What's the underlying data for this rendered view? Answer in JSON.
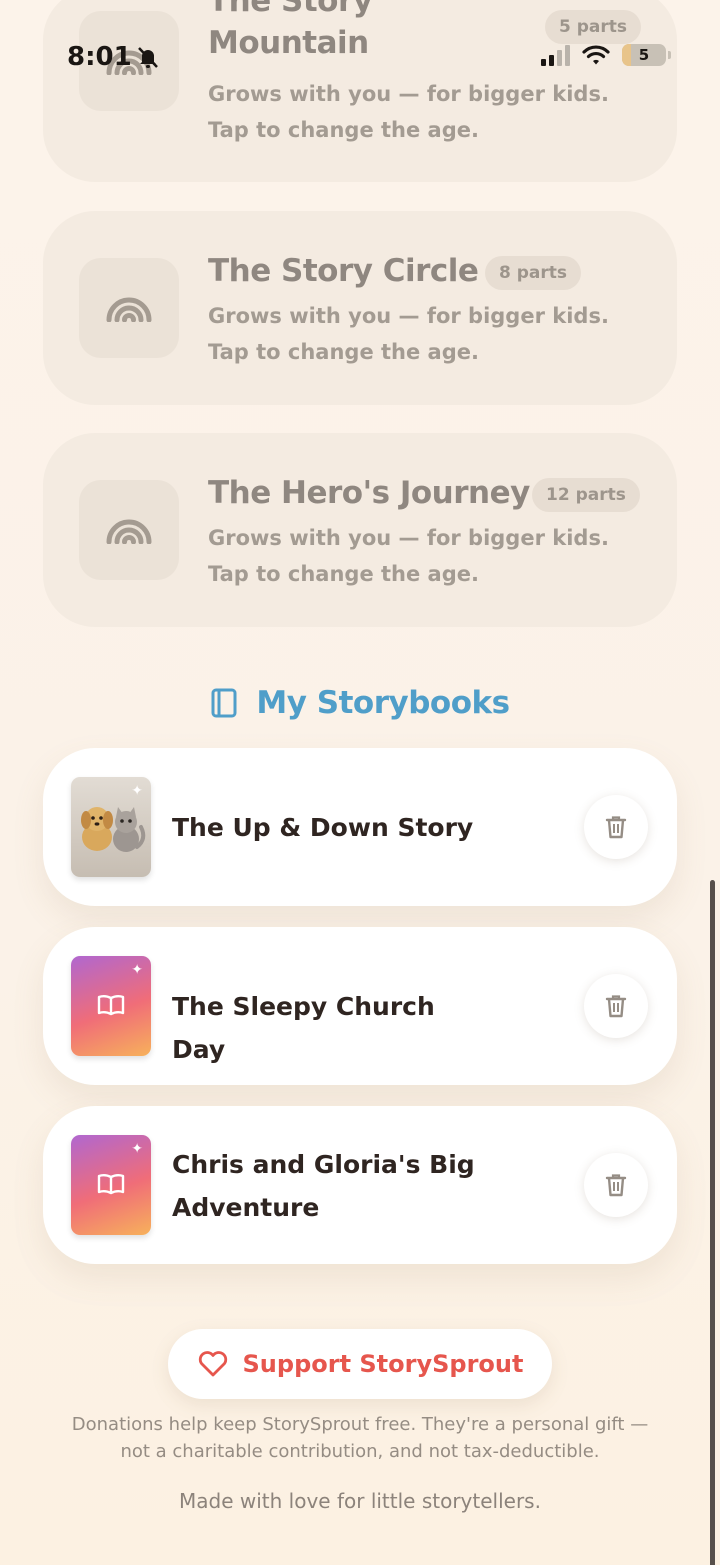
{
  "status_bar": {
    "time": "8:01",
    "battery": "5"
  },
  "frameworks": [
    {
      "title": "The Story Mountain",
      "parts": "5 parts",
      "description": "Grows with you — for bigger kids. Tap to change the age.",
      "icon": "rainbow-icon"
    },
    {
      "title": "The Story Circle",
      "parts": "8 parts",
      "description": "Grows with you — for bigger kids. Tap to change the age.",
      "icon": "rainbow-icon"
    },
    {
      "title": "The Hero's Journey",
      "parts": "12 parts",
      "description": "Grows with you — for bigger kids. Tap to change the age.",
      "icon": "rainbow-icon"
    }
  ],
  "storybooks_section": {
    "title": "My Storybooks",
    "icon": "book-icon"
  },
  "storybooks": [
    {
      "title": "The Up & Down Story",
      "cover": "pet illustration",
      "icon": "trash-icon"
    },
    {
      "title": "The Sleepy Church Day",
      "cover": "gradient",
      "icon": "trash-icon"
    },
    {
      "title": "Chris and Gloria's Big Adventure",
      "cover": "gradient",
      "icon": "trash-icon"
    }
  ],
  "support": {
    "label": "Support StorySprout",
    "note": "Donations help keep StorySprout free. They're a personal gift — not a charitable contribution, and not tax-deductible."
  },
  "footer": "Made with love for little storytellers.",
  "colors": {
    "accent_blue": "#4f9ec9",
    "support_red": "#e6564d",
    "background": "#fcf3ea",
    "cover_gradient_start": "#b067d0",
    "cover_gradient_end": "#f7b15b"
  }
}
